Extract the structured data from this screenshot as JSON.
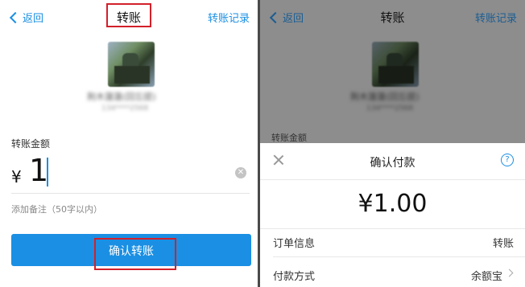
{
  "left": {
    "nav": {
      "back": "返回",
      "title": "转账",
      "record": "转账记录"
    },
    "recipient": {
      "name": "荆木蓮蓮(回忘提)",
      "id": "134****2568"
    },
    "amount_label": "转账金额",
    "currency": "¥",
    "amount": "1",
    "memo_placeholder": "添加备注（50字以内）",
    "confirm_label": "确认转账"
  },
  "right": {
    "nav": {
      "back": "返回",
      "title": "转账",
      "record": "转账记录"
    },
    "recipient": {
      "name": "荆木蓮蓮(回忘提)",
      "id": "134****2568"
    },
    "amount_label": "转账金额",
    "sheet": {
      "title": "确认付款",
      "amount": "¥1.00",
      "order_key": "订单信息",
      "order_val": "转账",
      "pay_key": "付款方式",
      "pay_val": "余额宝"
    }
  },
  "colors": {
    "accent": "#1a8fe3",
    "highlight": "#d2202a"
  }
}
